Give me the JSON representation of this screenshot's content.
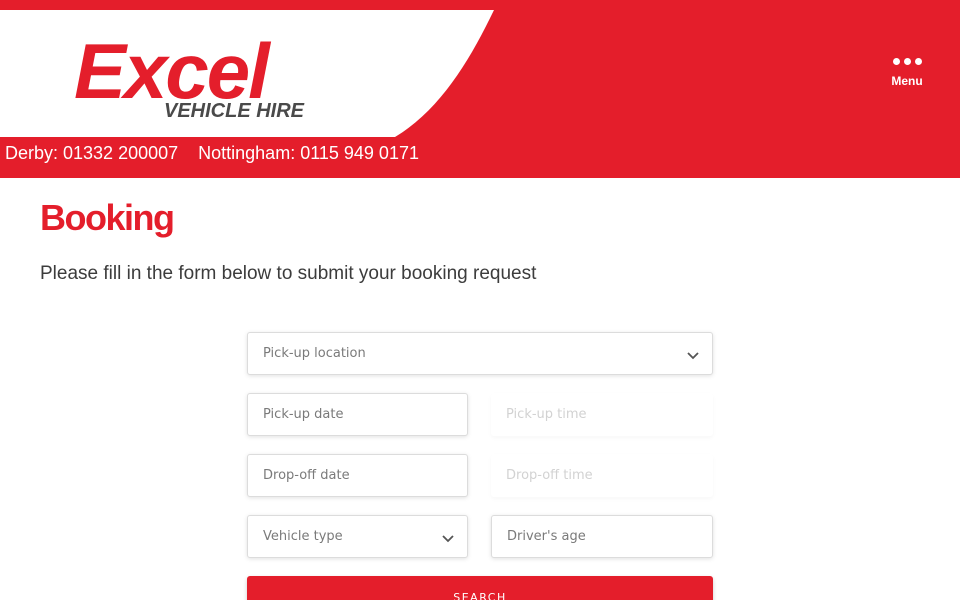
{
  "brand": {
    "name": "Excel",
    "tagline": "VEHICLE HIRE",
    "primary_color": "#e41e2b"
  },
  "header": {
    "menu_label": "Menu",
    "menu_icon": "ellipsis-icon",
    "phones": [
      "Derby: 01332 200007",
      "Nottingham: 0115 949 0171"
    ]
  },
  "main": {
    "title": "Booking",
    "intro": "Please fill in the form below to submit your booking request"
  },
  "form": {
    "pickup_location": "Pick-up location",
    "pickup_date": "Pick-up date",
    "pickup_time": "Pick-up time",
    "dropoff_date": "Drop-off date",
    "dropoff_time": "Drop-off time",
    "vehicle_type": "Vehicle type",
    "driver_age": "Driver's age",
    "search_label": "SEARCH"
  }
}
